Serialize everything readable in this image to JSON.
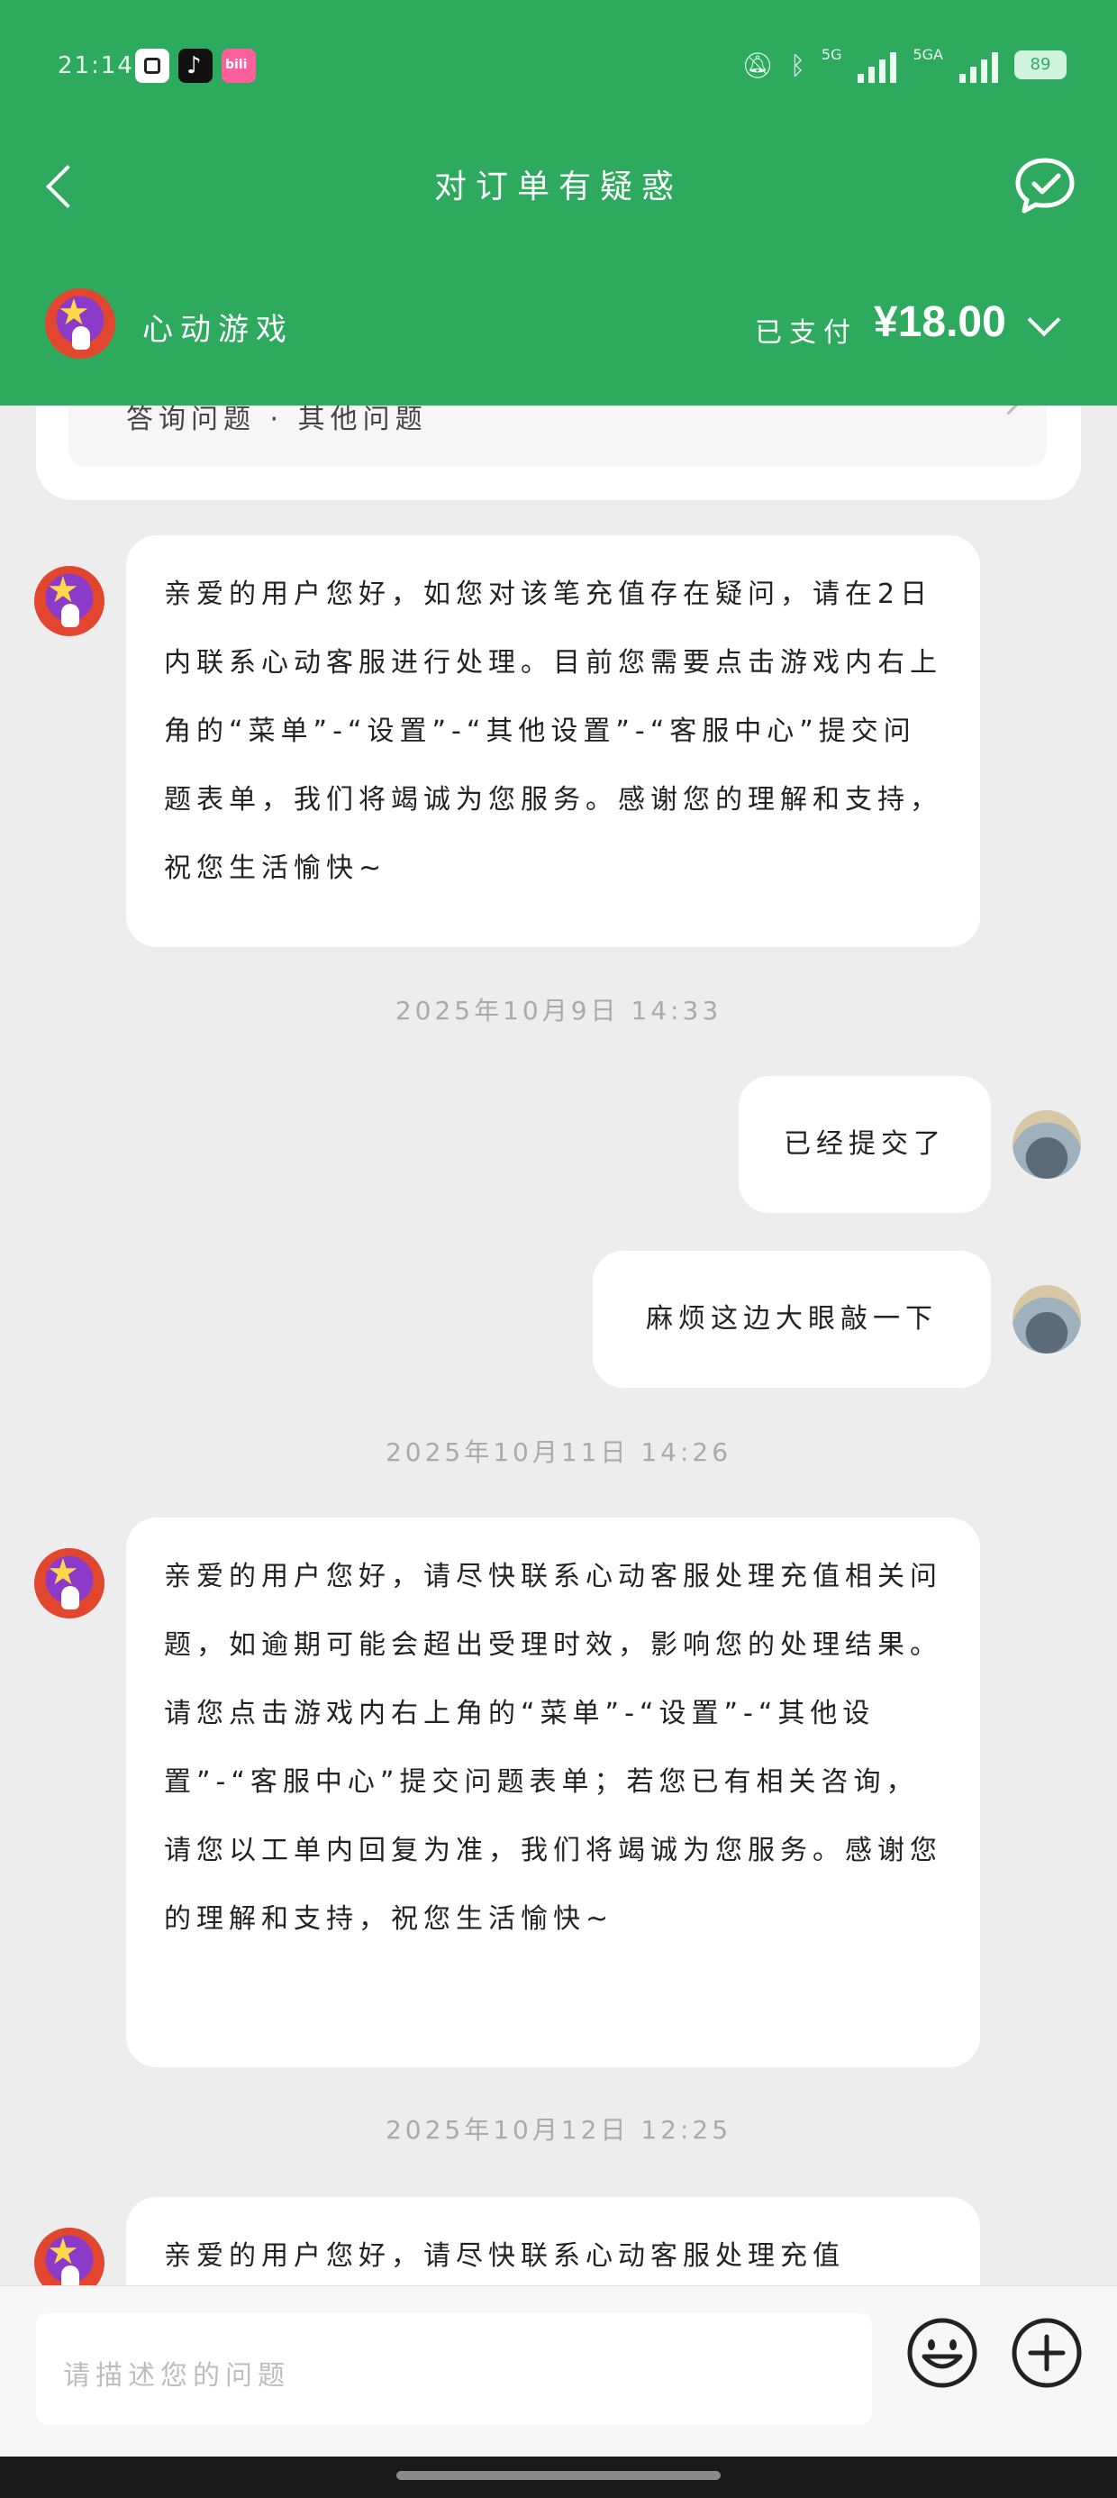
{
  "status_bar": {
    "time": "21:14",
    "network_left": "5G",
    "network_right": "5GA",
    "battery": "89",
    "apps": [
      "app-icon-square",
      "tiktok-icon",
      "bilibili-icon"
    ]
  },
  "header": {
    "title": "对订单有疑惑",
    "back_icon": "chevron-left-icon",
    "action_icon": "chat-check-icon"
  },
  "order": {
    "game_name": "心动游戏",
    "paid_label": "已支付",
    "paid_amount": "¥18.00",
    "partial_text": "答询问题 · 其他问题"
  },
  "messages": [
    {
      "from": "service",
      "text": "亲爱的用户您好，如您对该笔充值存在疑问，请在2日内联系心动客服进行处理。目前您需要点击游戏内右上角的“菜单”-“设置”-“其他设置”-“客服中心”提交问题表单，我们将竭诚为您服务。感谢您的理解和支持，祝您生活愉快~"
    },
    {
      "timestamp": "2025年10月9日 14:33"
    },
    {
      "from": "user",
      "text": "已经提交了"
    },
    {
      "from": "user",
      "text": "麻烦这边大眼敲一下"
    },
    {
      "timestamp": "2025年10月11日 14:26"
    },
    {
      "from": "service",
      "text": "亲爱的用户您好，请尽快联系心动客服处理充值相关问题，如逾期可能会超出受理时效，影响您的处理结果。请您点击游戏内右上角的“菜单”-“设置”-“其他设置”-“客服中心”提交问题表单；若您已有相关咨询，请您以工单内回复为准，我们将竭诚为您服务。感谢您的理解和支持，祝您生活愉快~"
    },
    {
      "timestamp": "2025年10月12日 12:25"
    },
    {
      "from": "service",
      "text": "亲爱的用户您好，请尽快联系心动客服处理充值"
    }
  ],
  "input": {
    "placeholder": "请描述您的问题"
  },
  "colors": {
    "brand_green": "#2EAA5E",
    "background": "#EDEDED",
    "bubble": "#FFFFFF",
    "timestamp": "#AAAAAA"
  }
}
